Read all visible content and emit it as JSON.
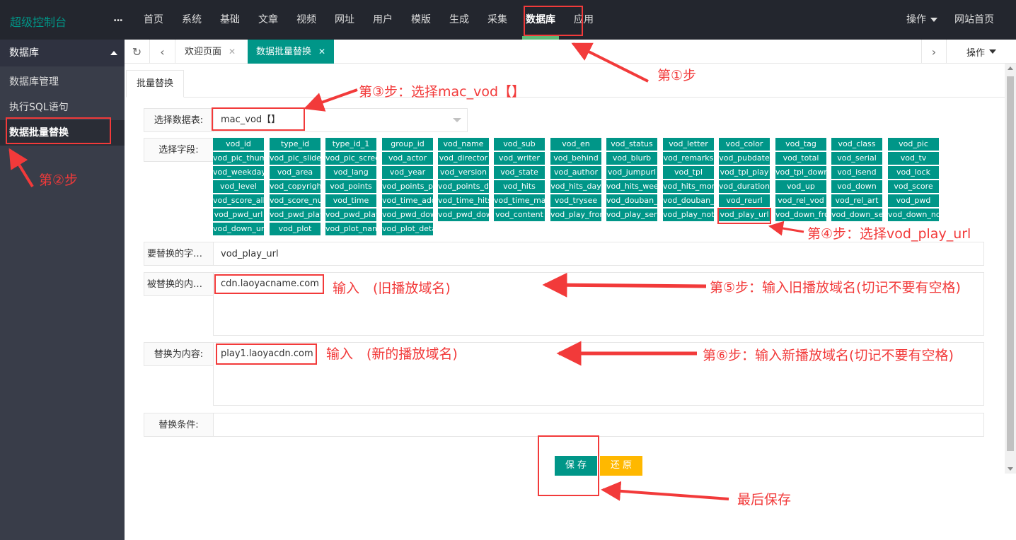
{
  "app": {
    "brand": "超级控制台",
    "more": "..."
  },
  "nav": [
    "首页",
    "系统",
    "基础",
    "文章",
    "视频",
    "网址",
    "用户",
    "模版",
    "生成",
    "采集",
    "数据库",
    "应用"
  ],
  "nav_active": "数据库",
  "topright": {
    "action": "操作",
    "site_home": "网站首页"
  },
  "sidebar": {
    "heading": "数据库",
    "items": [
      "数据库管理",
      "执行SQL语句",
      "数据批量替换"
    ]
  },
  "tabs": {
    "welcome": "欢迎页面",
    "active": "数据批量替换",
    "ops": "操作"
  },
  "form": {
    "subtab": "批量替换",
    "table_label": "选择数据表:",
    "table_value": "mac_vod【】",
    "field_label": "选择字段:",
    "field_to_replace_label": "要替换的字段...",
    "field_to_replace_value": "vod_play_url",
    "old_label": "被替换的内容...",
    "old_value": "cdn.laoyacname.com",
    "new_label": "替换为内容:",
    "new_value": "play1.laoyacdn.com",
    "condition_label": "替换条件:",
    "save": "保 存",
    "reset": "还 原"
  },
  "fields": [
    "vod_id",
    "type_id",
    "type_id_1",
    "group_id",
    "vod_name",
    "vod_sub",
    "vod_en",
    "vod_status",
    "vod_letter",
    "vod_color",
    "vod_tag",
    "vod_class",
    "vod_pic",
    "vod_pic_thumb",
    "vod_pic_slide",
    "vod_pic_screenshot",
    "vod_actor",
    "vod_director",
    "vod_writer",
    "vod_behind",
    "vod_blurb",
    "vod_remarks",
    "vod_pubdate",
    "vod_total",
    "vod_serial",
    "vod_tv",
    "vod_weekday",
    "vod_area",
    "vod_lang",
    "vod_year",
    "vod_version",
    "vod_state",
    "vod_author",
    "vod_jumpurl",
    "vod_tpl",
    "vod_tpl_play",
    "vod_tpl_down",
    "vod_isend",
    "vod_lock",
    "vod_level",
    "vod_copyright",
    "vod_points",
    "vod_points_play",
    "vod_points_down",
    "vod_hits",
    "vod_hits_day",
    "vod_hits_week",
    "vod_hits_month",
    "vod_duration",
    "vod_up",
    "vod_down",
    "vod_score",
    "vod_score_all",
    "vod_score_num",
    "vod_time",
    "vod_time_add",
    "vod_time_hits",
    "vod_time_make",
    "vod_trysee",
    "vod_douban_id",
    "vod_douban_score",
    "vod_reurl",
    "vod_rel_vod",
    "vod_rel_art",
    "vod_pwd",
    "vod_pwd_url",
    "vod_pwd_play",
    "vod_pwd_play_url",
    "vod_pwd_down",
    "vod_pwd_down_url",
    "vod_content",
    "vod_play_from",
    "vod_play_server",
    "vod_play_note",
    "vod_play_url",
    "vod_down_from",
    "vod_down_server",
    "vod_down_note",
    "vod_down_url",
    "vod_plot",
    "vod_plot_name",
    "vod_plot_detail"
  ],
  "annotations": {
    "step1": "第①步",
    "step2": "第②步",
    "step3": "第③步：选择mac_vod【】",
    "step4": "第④步：选择vod_play_url",
    "step5": "第⑤步：输入旧播放域名(切记不要有空格)",
    "step6": "第⑥步：输入新播放域名(切记不要有空格)",
    "input_old": "输入　(旧播放域名)",
    "input_new": "输入　(新的播放域名)",
    "final": "最后保存"
  },
  "colors": {
    "accent": "#009688",
    "topbar": "#23262e",
    "sidebar": "#393d49",
    "reset": "#ffb800",
    "annotation": "#f23a3a"
  }
}
